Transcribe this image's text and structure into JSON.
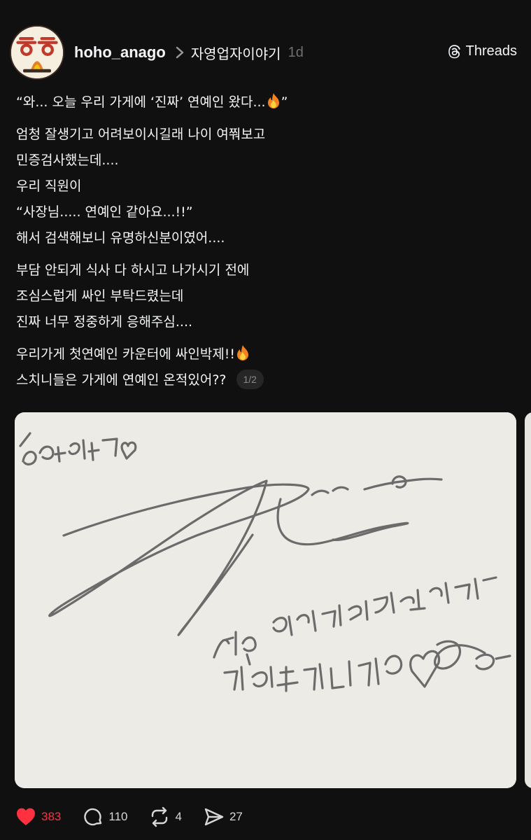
{
  "post": {
    "username": "hoho_anago",
    "topic": "자영업자이야기",
    "time": "1d",
    "app_label": "Threads",
    "avatar_text": "ㅎㅎ",
    "paragraphs": [
      [
        "“와... 오늘 우리 가게에 ‘진짜’ 연예인 왔다..."
      ],
      [
        "엄청 잘생기고 어려보이시길래 나이 여쭤보고",
        "민증검사했는데....",
        "우리 직원이",
        "“사장님..... 연예인 같아요...!!”",
        "해서 검색해보니 유명하신분이였어...."
      ],
      [
        "부담 안되게 식사 다 하시고 나가시기 전에",
        "조심스럽게 싸인 부탁드렸는데",
        "진짜 너무 정중하게 응해주심...."
      ],
      [
        "우리가게 첫연예인 카운터에 싸인박제!!",
        "스치니들은 가게에 연예인 온적있어??"
      ]
    ],
    "quote_close": "”",
    "page_indicator": "1/2",
    "image": {
      "description": "handwritten autograph on white card",
      "handwritten_text": [
        "호호아나고",
        "너무 맛있게 잘 먹었습니다",
        "감사합니다"
      ]
    }
  },
  "actions": {
    "likes": "383",
    "replies": "110",
    "reposts": "4",
    "shares": "27"
  },
  "colors": {
    "background": "#101010",
    "text": "#f3f5f7",
    "muted": "#6f6f6f",
    "like": "#ff3040"
  },
  "icons": [
    "threads-logo-icon",
    "chevron-right-icon",
    "fire-emoji-icon",
    "heart-filled-icon",
    "comment-icon",
    "repost-icon",
    "share-icon"
  ]
}
